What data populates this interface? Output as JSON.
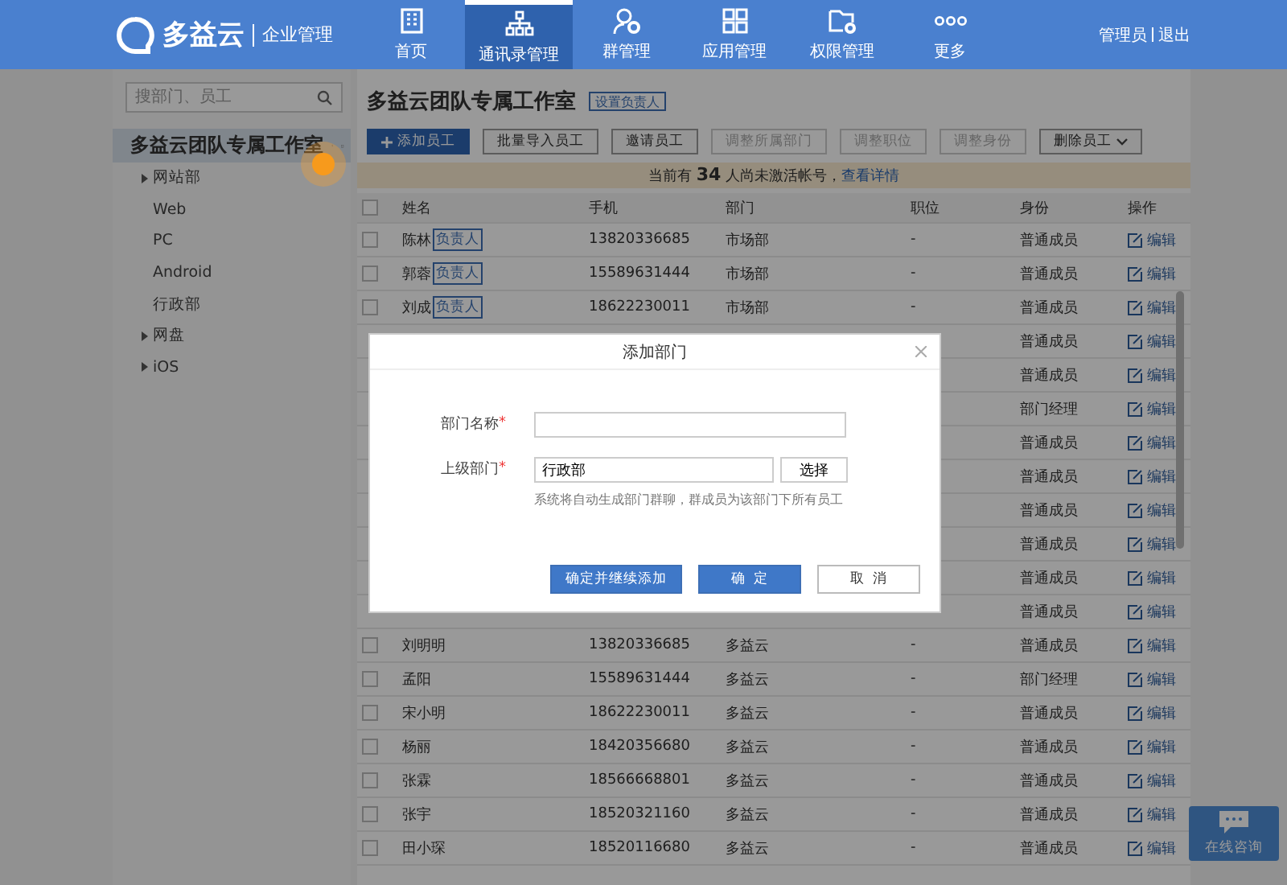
{
  "header": {
    "logo_text": "多益云",
    "logo_subtitle": "企业管理",
    "nav": [
      {
        "label": "首页",
        "selected": false
      },
      {
        "label": "通讯录管理",
        "selected": true
      },
      {
        "label": "群管理",
        "selected": false
      },
      {
        "label": "应用管理",
        "selected": false
      },
      {
        "label": "权限管理",
        "selected": false
      },
      {
        "label": "更多",
        "selected": false
      }
    ],
    "user_links": [
      "管理员",
      "退出"
    ]
  },
  "sidebar": {
    "search_placeholder": "搜部门、员工",
    "org_name": "多益云团队专属工作室",
    "tree": [
      {
        "label": "网站部",
        "has_children": true
      },
      {
        "label": "Web",
        "has_children": false
      },
      {
        "label": "PC",
        "has_children": false
      },
      {
        "label": "Android",
        "has_children": false
      },
      {
        "label": "行政部",
        "has_children": false
      },
      {
        "label": "网盘",
        "has_children": true
      },
      {
        "label": "iOS",
        "has_children": true
      }
    ]
  },
  "main": {
    "title": "多益云团队专属工作室",
    "set_manager": "设置负责人",
    "toolbar": [
      {
        "label": "添加员工",
        "kind": "primary"
      },
      {
        "label": "批量导入员工",
        "kind": "default"
      },
      {
        "label": "邀请员工",
        "kind": "default"
      },
      {
        "label": "调整所属部门",
        "kind": "disabled"
      },
      {
        "label": "调整职位",
        "kind": "disabled"
      },
      {
        "label": "调整身份",
        "kind": "disabled"
      },
      {
        "label": "删除员工",
        "kind": "dropdown"
      }
    ],
    "notice": {
      "text": "当前有 **34** 人尚未激活帐号，",
      "link": "查看详情"
    },
    "columns": [
      "姓名",
      "手机",
      "部门",
      "职位",
      "身份",
      "操作"
    ],
    "select_all_checked": false,
    "rows": [
      {
        "checked": false,
        "name": "陈林",
        "tag": "负责人",
        "phone": "13820336685",
        "dept": "市场部",
        "position": "-",
        "role": "普通成员",
        "action": "编辑"
      },
      {
        "checked": false,
        "name": "郭蓉",
        "tag": "负责人",
        "phone": "15589631444",
        "dept": "市场部",
        "position": "-",
        "role": "普通成员",
        "action": "编辑"
      },
      {
        "checked": false,
        "name": "刘成",
        "tag": "负责人",
        "phone": "18622230011",
        "dept": "市场部",
        "position": "-",
        "role": "普通成员",
        "action": "编辑"
      },
      {
        "role": "普通成员",
        "action": "编辑"
      },
      {
        "role": "普通成员",
        "action": "编辑"
      },
      {
        "role": "部门经理",
        "action": "编辑"
      },
      {
        "role": "普通成员",
        "action": "编辑"
      },
      {
        "role": "普通成员",
        "action": "编辑"
      },
      {
        "role": "普通成员",
        "action": "编辑"
      },
      {
        "role": "普通成员",
        "action": "编辑"
      },
      {
        "role": "普通成员",
        "action": "编辑"
      },
      {
        "role": "普通成员",
        "action": "编辑"
      },
      {
        "checked": false,
        "name": "刘明明",
        "phone": "13820336685",
        "dept": "多益云",
        "position": "-",
        "role": "普通成员",
        "action": "编辑"
      },
      {
        "checked": false,
        "name": "孟阳",
        "phone": "15589631444",
        "dept": "多益云",
        "position": "-",
        "role": "部门经理",
        "action": "编辑"
      },
      {
        "checked": false,
        "name": "宋小明",
        "phone": "18622230011",
        "dept": "多益云",
        "position": "-",
        "role": "普通成员",
        "action": "编辑"
      },
      {
        "checked": false,
        "name": "杨丽",
        "phone": "18420356680",
        "dept": "多益云",
        "position": "-",
        "role": "普通成员",
        "action": "编辑"
      },
      {
        "checked": false,
        "name": "张霖",
        "phone": "18566668801",
        "dept": "多益云",
        "position": "-",
        "role": "普通成员",
        "action": "编辑"
      },
      {
        "checked": false,
        "name": "张宇",
        "phone": "18520321160",
        "dept": "多益云",
        "position": "-",
        "role": "普通成员",
        "action": "编辑"
      },
      {
        "checked": false,
        "name": "田小琛",
        "phone": "18520116680",
        "dept": "多益云",
        "position": "-",
        "role": "普通成员",
        "action": "编辑"
      }
    ]
  },
  "chat_button": "在线咨询",
  "dialog": {
    "title": "添加部门",
    "fields": [
      {
        "label": "部门名称",
        "required_mark": "*"
      },
      {
        "label": "上级部门",
        "required_mark": "*",
        "value": "行政部",
        "button": "选择",
        "hint": "系统将自动生成部门群聊，群成员为该部门下所有员工"
      }
    ],
    "buttons": [
      {
        "label": "确定并继续添加",
        "kind": "primary"
      },
      {
        "label": "确  定",
        "kind": "primary"
      },
      {
        "label": "取  消",
        "kind": "default"
      }
    ]
  }
}
